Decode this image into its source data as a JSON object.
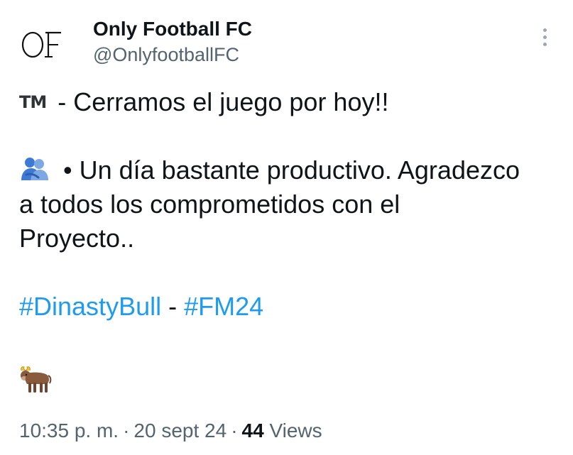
{
  "author": {
    "display_name": "Only Football FC",
    "handle": "@OnlyfootballFC",
    "avatar_icon": "of-monogram-logo",
    "avatar_text": "OF"
  },
  "menu": {
    "more_icon": "more-vertical-icon"
  },
  "tweet": {
    "tm_label": "TM",
    "line1": " - Cerramos el juego por hoy!!",
    "hug_emoji_icon": "people-hugging-icon",
    "line2": " • Un día bastante productivo. Agradezco",
    "line3": "a todos los comprometidos con el",
    "line4": "Proyecto..",
    "hashtag1": "#DinastyBull",
    "hashtag_sep": " - ",
    "hashtag2": "#FM24",
    "bull_emoji_icon": "ox-icon"
  },
  "meta": {
    "time": "10:35 p. m.",
    "sep": "·",
    "date": "20 sept 24",
    "views_count": "44",
    "views_label": " Views"
  },
  "colors": {
    "link": "#1d9bf0",
    "secondary_text": "#536471",
    "primary_text": "#0f1419"
  }
}
